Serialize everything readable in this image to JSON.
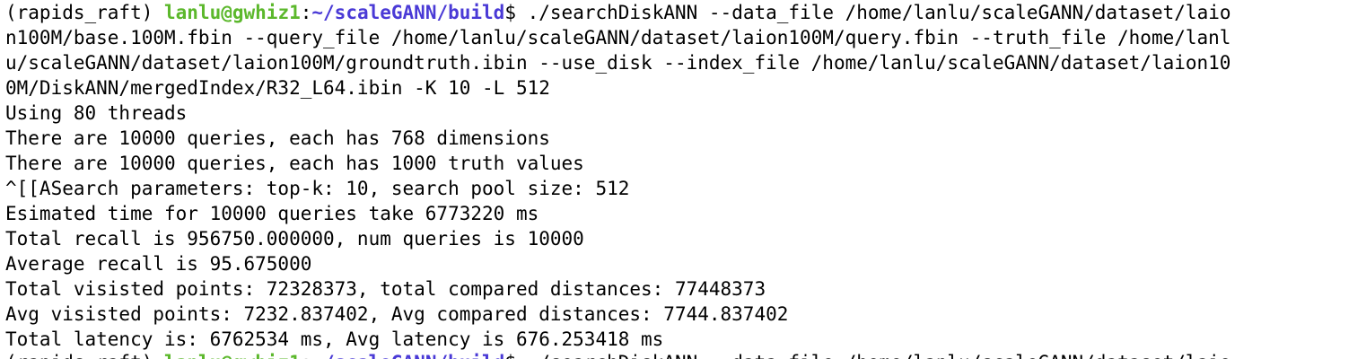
{
  "terminal": {
    "prompt": {
      "env": "(rapids_raft) ",
      "user_host": "lanlu@gwhiz1",
      "colon": ":",
      "path": "~/scaleGANN/build",
      "dollar": "$ "
    },
    "command_lines": [
      "./searchDiskANN --data_file /home/lanlu/scaleGANN/dataset/laio",
      "n100M/base.100M.fbin --query_file /home/lanlu/scaleGANN/dataset/laion100M/query.fbin --truth_file /home/lanl",
      "u/scaleGANN/dataset/laion100M/groundtruth.ibin --use_disk --index_file /home/lanlu/scaleGANN/dataset/laion10",
      "0M/DiskANN/mergedIndex/R32_L64.ibin -K 10 -L 512"
    ],
    "output_lines": [
      "Using 80 threads",
      "There are 10000 queries, each has 768 dimensions",
      "There are 10000 queries, each has 1000 truth values",
      "^[[ASearch parameters: top-k: 10, search pool size: 512",
      "Esimated time for 10000 queries take 6773220 ms",
      "Total recall is 956750.000000, num queries is 10000",
      "Average recall is 95.675000",
      "Total visisted points: 72328373, total compared distances: 77448373",
      "Avg visisted points: 7232.837402, Avg compared distances: 7744.837402",
      "Total latency is: 6762534 ms, Avg latency is 676.253418 ms"
    ],
    "colors": {
      "background": "#ffffff",
      "text": "#000000",
      "user_host": "#5cb82c",
      "path": "#4a3ad6"
    }
  }
}
